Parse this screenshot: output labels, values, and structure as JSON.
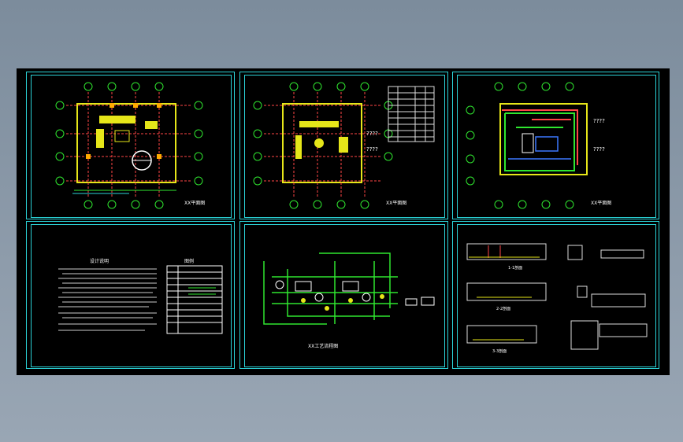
{
  "drawing": {
    "background": "#000000",
    "frame_color": "#2bd3d8",
    "panels": [
      {
        "id": "p1",
        "type": "floor-plan",
        "title": "XX平面图",
        "axes_top": [
          "7",
          "8",
          "9",
          "10"
        ],
        "axes_left": [
          "F",
          "E",
          "D",
          "C"
        ]
      },
      {
        "id": "p2",
        "type": "floor-plan",
        "title": "XX平面图",
        "axes_top": [
          "7",
          "8",
          "9",
          "10"
        ],
        "axes_left": [
          "F",
          "E",
          "D",
          "C"
        ],
        "notes": [
          "????",
          "????"
        ]
      },
      {
        "id": "p3",
        "type": "piping-plan",
        "title": "XX平面图",
        "axes_top": [
          "7",
          "8",
          "9",
          "10"
        ],
        "axes_left": [
          "F",
          "E",
          "D",
          "C"
        ],
        "notes": [
          "????",
          "????"
        ]
      },
      {
        "id": "p4",
        "type": "notes",
        "title": "设计说明",
        "legend_title": "图例"
      },
      {
        "id": "p5",
        "type": "system-diagram",
        "title": "XX工艺流程图"
      },
      {
        "id": "p6",
        "type": "sections",
        "labels": [
          "1-1剖面",
          "2-2剖面",
          "3-3剖面"
        ]
      }
    ]
  }
}
